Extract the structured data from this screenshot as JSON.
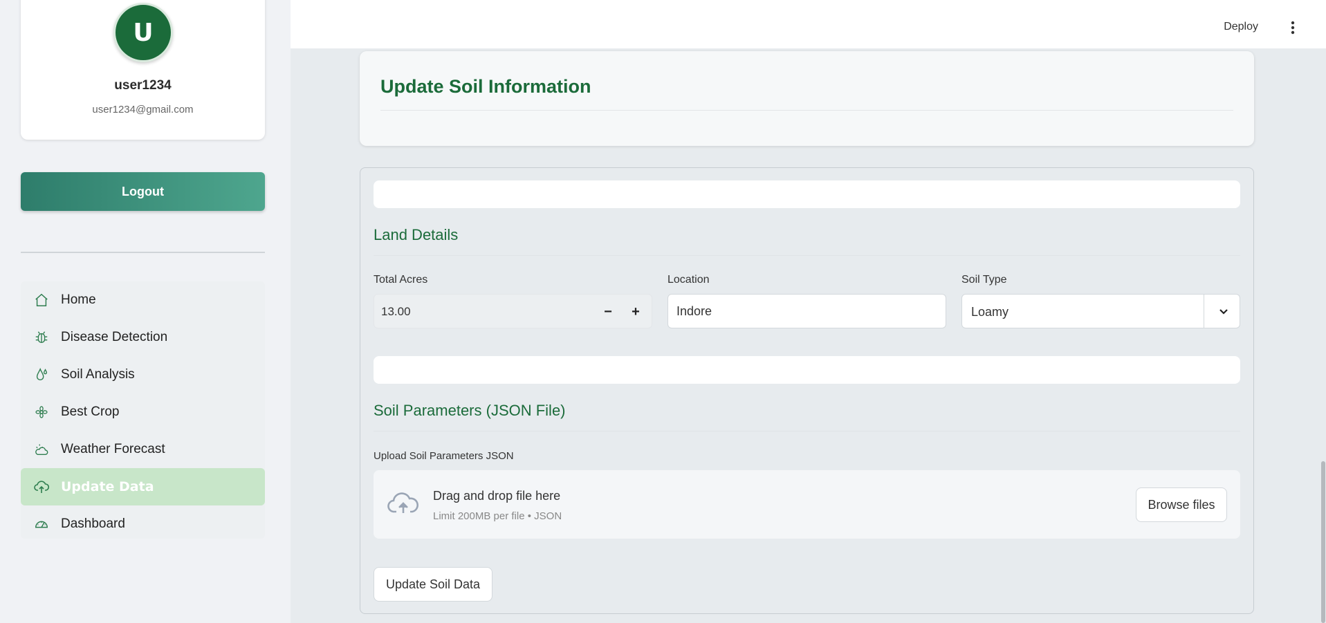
{
  "sidebar": {
    "profile": {
      "initial": "U",
      "username": "user1234",
      "email": "user1234@gmail.com"
    },
    "logout_label": "Logout",
    "nav": [
      {
        "label": "Home",
        "icon": "home-icon"
      },
      {
        "label": "Disease Detection",
        "icon": "bug-icon"
      },
      {
        "label": "Soil Analysis",
        "icon": "droplet-icon"
      },
      {
        "label": "Best Crop",
        "icon": "flower-icon"
      },
      {
        "label": "Weather Forecast",
        "icon": "cloud-sun-icon"
      },
      {
        "label": "Update Data",
        "icon": "cloud-upload-icon",
        "active": true
      },
      {
        "label": "Dashboard",
        "icon": "speedometer-icon"
      }
    ]
  },
  "header": {
    "deploy_label": "Deploy",
    "menu_icon": "kebab-menu-icon"
  },
  "main": {
    "title": "Update Soil Information",
    "land_details": {
      "heading": "Land Details",
      "total_acres": {
        "label": "Total Acres",
        "value": "13.00",
        "minus": "−",
        "plus": "+"
      },
      "location": {
        "label": "Location",
        "value": "Indore"
      },
      "soil_type": {
        "label": "Soil Type",
        "value": "Loamy"
      }
    },
    "soil_params": {
      "heading": "Soil Parameters (JSON File)",
      "upload_label": "Upload Soil Parameters JSON",
      "drop_title": "Drag and drop file here",
      "drop_sub": "Limit 200MB per file • JSON",
      "browse_label": "Browse files"
    },
    "submit_label": "Update Soil Data"
  },
  "colors": {
    "accent": "#1b6b3a",
    "active_nav": "#c8e6c9",
    "logout_start": "#2e7d6b",
    "logout_end": "#4ea68e"
  }
}
